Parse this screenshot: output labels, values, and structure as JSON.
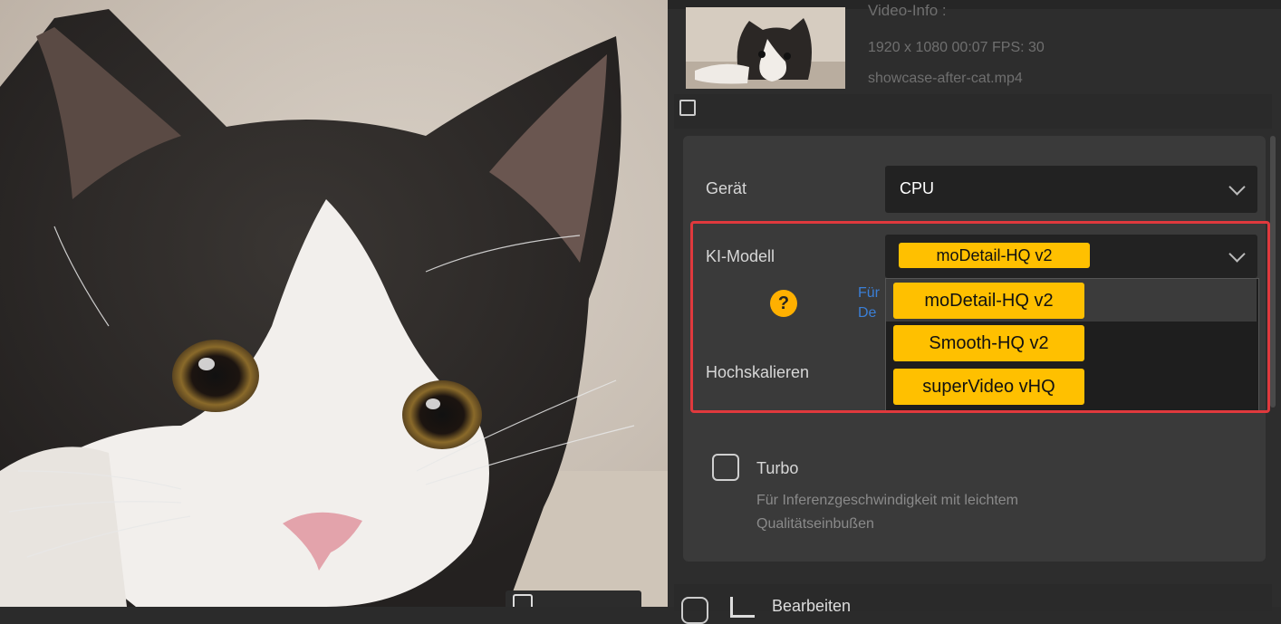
{
  "video_info": {
    "title": "Video-Info :",
    "resolution_duration_fps": "1920 x 1080  00:07    FPS: 30",
    "filename": "showcase-after-cat.mp4"
  },
  "section_header": "moDetail-HQ",
  "device": {
    "label": "Gerät",
    "value": "CPU"
  },
  "model": {
    "label": "KI-Modell",
    "selected": "moDetail-HQ  v2",
    "help_text_partial": "Für",
    "help_text_partial2": "De",
    "options": [
      "moDetail-HQ  v2",
      "Smooth-HQ  v2",
      "superVideo vHQ"
    ]
  },
  "upscale": {
    "label": "Hochskalieren"
  },
  "turbo": {
    "label": "Turbo",
    "description_line1": "Für Inferenzgeschwindigkeit mit leichtem",
    "description_line2": "Qualitätseinbußen",
    "checked": false
  },
  "bottom_section": {
    "label": "Bearbeiten"
  },
  "colors": {
    "accent": "#ffc000",
    "highlight_border": "#e0393d",
    "link": "#3a7fd6"
  }
}
